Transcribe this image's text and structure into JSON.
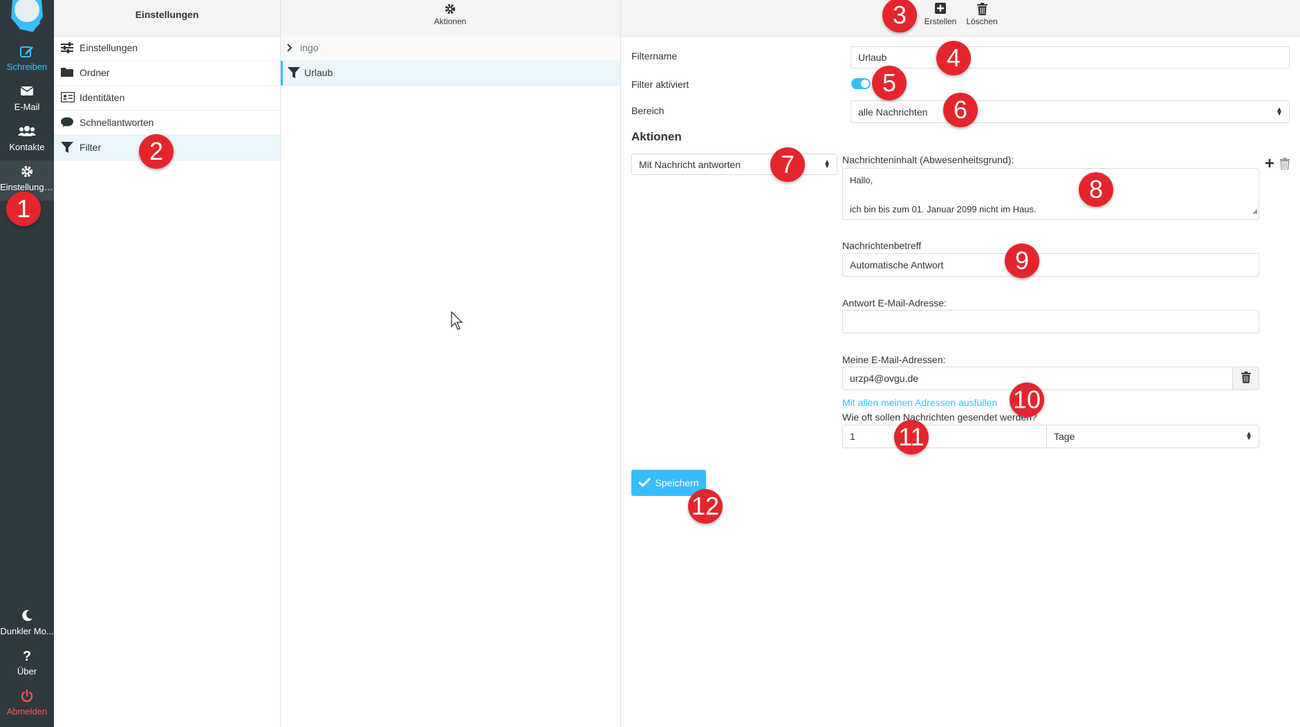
{
  "nav": {
    "items": [
      {
        "label": "Schreiben",
        "icon": "compose-icon"
      },
      {
        "label": "E-Mail",
        "icon": "envelope-icon"
      },
      {
        "label": "Kontakte",
        "icon": "contacts-icon"
      },
      {
        "label": "Einstellungen",
        "icon": "gear-icon"
      }
    ],
    "bottom": [
      {
        "label": "Dunkler Mo...",
        "icon": "moon-icon"
      },
      {
        "label": "Über",
        "icon": "question-icon"
      },
      {
        "label": "Abmelden",
        "icon": "power-icon"
      }
    ]
  },
  "settings_panel": {
    "title": "Einstellungen",
    "items": [
      {
        "label": "Einstellungen",
        "icon": "sliders-icon"
      },
      {
        "label": "Ordner",
        "icon": "folder-icon"
      },
      {
        "label": "Identitäten",
        "icon": "id-card-icon"
      },
      {
        "label": "Schnellantworten",
        "icon": "comment-icon"
      },
      {
        "label": "Filter",
        "icon": "filter-icon"
      }
    ]
  },
  "filter_list": {
    "actions_label": "Aktionen",
    "group": "ingo",
    "items": [
      {
        "label": "Urlaub"
      }
    ]
  },
  "toolbar": {
    "create_label": "Erstellen",
    "delete_label": "Löschen"
  },
  "form": {
    "filtername_label": "Filtername",
    "filtername_value": "Urlaub",
    "enabled_label": "Filter aktiviert",
    "scope_label": "Bereich",
    "scope_value": "alle Nachrichten",
    "actions_heading": "Aktionen",
    "action_value": "Mit Nachricht antworten",
    "body_label": "Nachrichteninhalt (Abwesenheitsgrund):",
    "body_line1": "Hallo,",
    "body_line2": "ich bin bis zum 01. Januar 2099 nicht im Haus.",
    "subject_label": "Nachrichtenbetreff",
    "subject_value": "Automatische Antwort",
    "reply_address_label": "Antwort E-Mail-Adresse:",
    "reply_address_value": "",
    "my_addresses_label": "Meine E-Mail-Adressen:",
    "my_address_value": "urzp4@ovgu.de",
    "fill_all_link": "Mit allen meinen Adressen ausfüllen",
    "frequency_label": "Wie oft sollen Nachrichten gesendet werden?",
    "frequency_value": "1",
    "frequency_unit": "Tage",
    "save_label": "Speichern"
  },
  "callouts": [
    "1",
    "2",
    "3",
    "4",
    "5",
    "6",
    "7",
    "8",
    "9",
    "10",
    "11",
    "12"
  ],
  "colors": {
    "accent": "#37beff",
    "sidebar": "#2f3a3f",
    "callout": "#e4262c",
    "logout": "#ff5552"
  }
}
